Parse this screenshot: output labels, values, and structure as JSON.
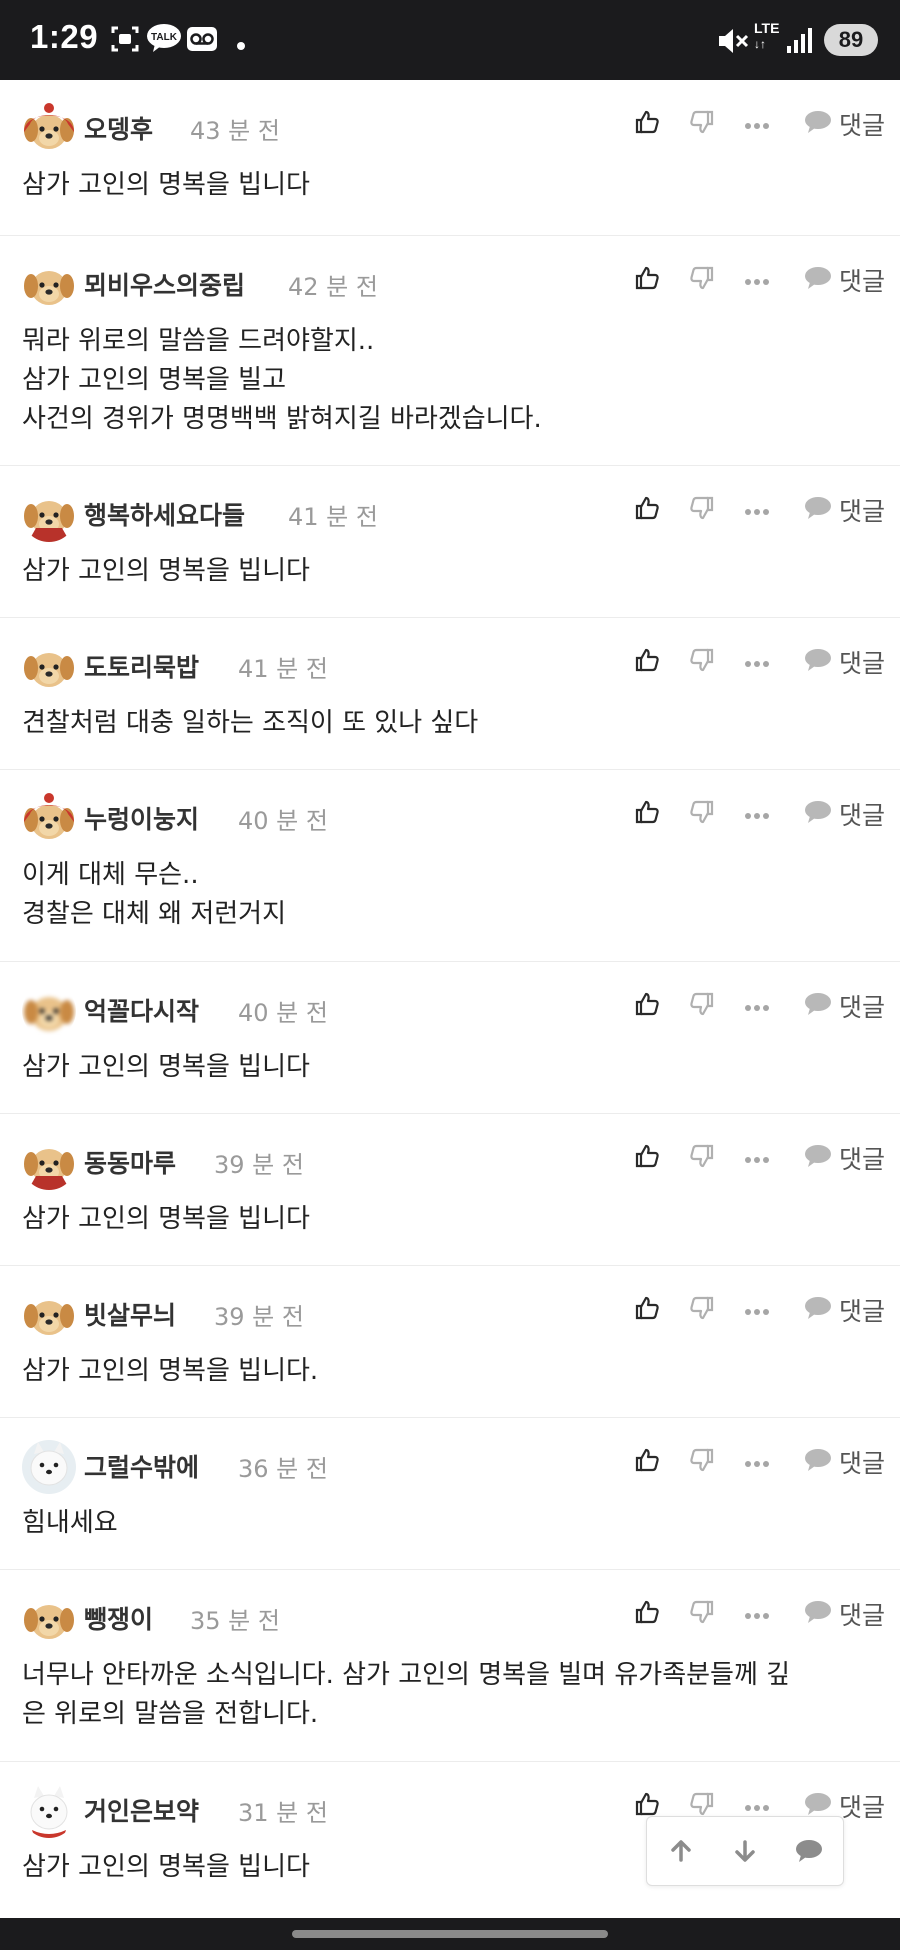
{
  "status_bar": {
    "time": "1:29",
    "talk_badge": "TALK",
    "network": "LTE",
    "battery": "89"
  },
  "actions": {
    "reply_label": "댓글"
  },
  "comments": [
    {
      "nickname": "오뎅후",
      "time": "43 분 전",
      "lines": [
        "삼가 고인의 명복을 빕니다"
      ]
    },
    {
      "nickname": "뫼비우스의중립",
      "time": "42 분 전",
      "lines": [
        "뭐라 위로의 말씀을 드려야할지..",
        "삼가 고인의 명복을 빌고",
        "사건의 경위가 명명백백 밝혀지길 바라겠습니다."
      ]
    },
    {
      "nickname": "행복하세요다들",
      "time": "41 분 전",
      "lines": [
        "삼가 고인의 명복을 빕니다"
      ]
    },
    {
      "nickname": "도토리묵밥",
      "time": "41 분 전",
      "lines": [
        "견찰처럼 대충 일하는 조직이 또 있나 싶다"
      ]
    },
    {
      "nickname": "누렁이눙지",
      "time": "40 분 전",
      "lines": [
        "이게 대체 무슨..",
        "경찰은 대체 왜 저런거지"
      ]
    },
    {
      "nickname": "억꼴다시작",
      "time": "40 분 전",
      "lines": [
        "삼가 고인의 명복을 빕니다"
      ]
    },
    {
      "nickname": "동동마루",
      "time": "39 분 전",
      "lines": [
        "삼가 고인의 명복을 빕니다"
      ]
    },
    {
      "nickname": "빗살무늬",
      "time": "39 분 전",
      "lines": [
        "삼가 고인의 명복을 빕니다."
      ]
    },
    {
      "nickname": "그럴수밖에",
      "time": "36 분 전",
      "lines": [
        "힘내세요"
      ]
    },
    {
      "nickname": "뺑쟁이",
      "time": "35 분 전",
      "lines": [
        "너무나 안타까운 소식입니다. 삼가 고인의 명복을 빌며 유가족분들께 깊",
        "은 위로의 말씀을 전합니다."
      ]
    },
    {
      "nickname": "거인은보약",
      "time": "31 분 전",
      "lines": [
        "삼가 고인의 명복을 빕니다"
      ]
    }
  ]
}
